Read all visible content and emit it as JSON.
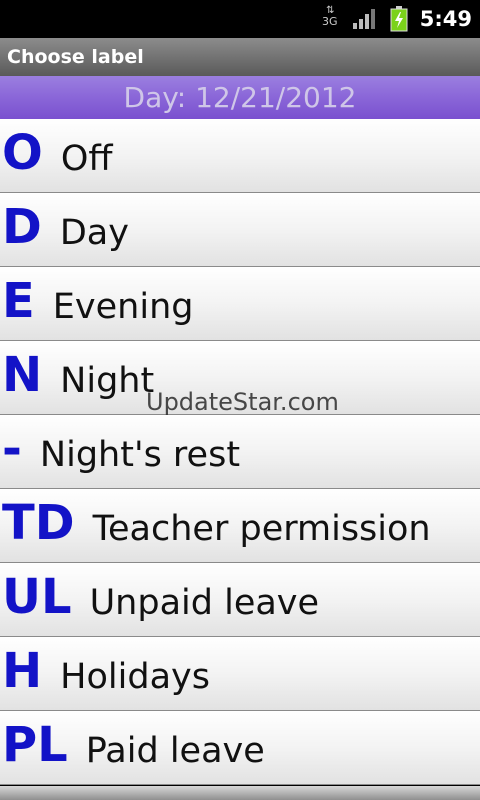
{
  "status_bar": {
    "network_type": "3G",
    "network_arrows": "⇅",
    "clock": "5:49"
  },
  "title_bar": {
    "title": "Choose label"
  },
  "header": {
    "day": "Day: 12/21/2012"
  },
  "labels": [
    {
      "code": "O",
      "name": "Off"
    },
    {
      "code": "D",
      "name": "Day"
    },
    {
      "code": "E",
      "name": "Evening"
    },
    {
      "code": "N",
      "name": "Night"
    },
    {
      "code": "-",
      "name": "Night's rest"
    },
    {
      "code": "TD",
      "name": "Teacher permission"
    },
    {
      "code": "UL",
      "name": "Unpaid leave"
    },
    {
      "code": "H",
      "name": "Holidays"
    },
    {
      "code": "PL",
      "name": "Paid leave"
    }
  ],
  "watermark": "UpdateStar.com",
  "colors": {
    "code_color": "#1313c7",
    "header_purple": "#8a66d8",
    "battery_green": "#7bd21a"
  }
}
